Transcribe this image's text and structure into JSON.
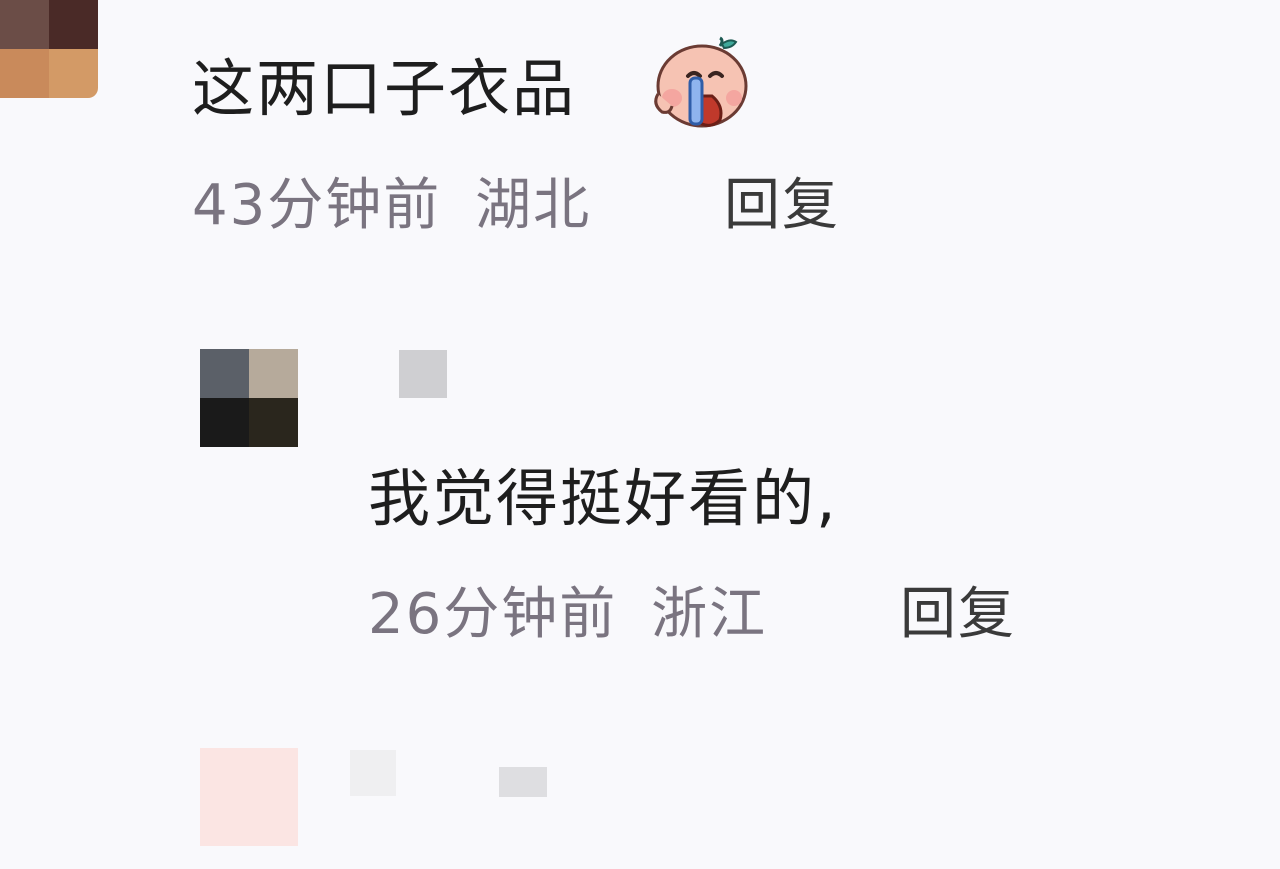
{
  "comments": [
    {
      "text": "这两口子衣品",
      "emoji_icon": "crying-face-icon",
      "time": "43分钟前",
      "location": "湖北",
      "reply_label": "回复"
    },
    {
      "text": "我觉得挺好看的,",
      "time": "26分钟前",
      "location": "浙江",
      "reply_label": "回复"
    }
  ],
  "colors": {
    "background": "#f9f9fc",
    "comment_text": "#1e1e1e",
    "meta_text": "#7a7480",
    "reply_text": "#3a3a3a"
  }
}
